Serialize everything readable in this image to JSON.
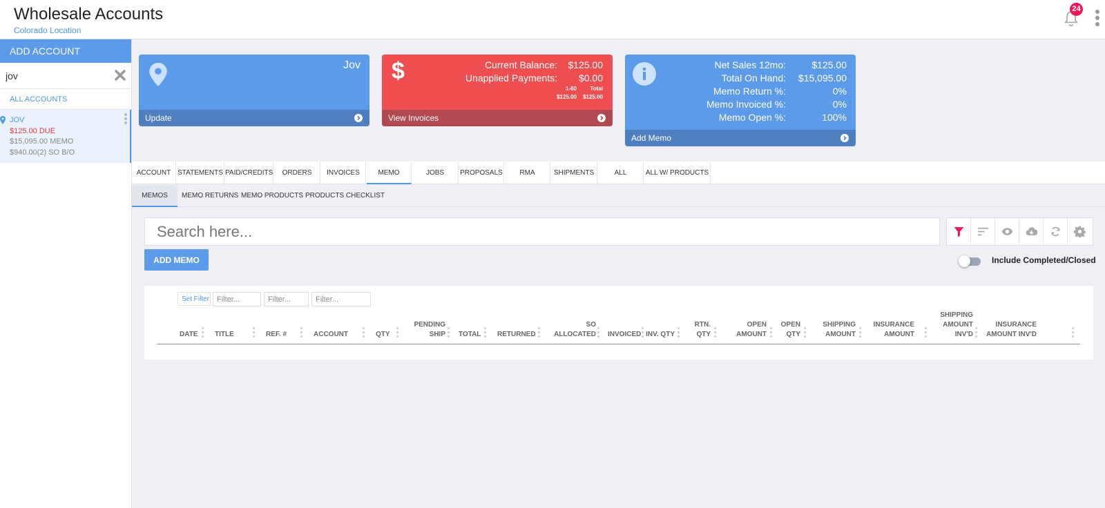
{
  "app": {
    "title": "Wholesale Accounts",
    "subtitle": "Colorado Location",
    "notifications": "24"
  },
  "sidebar": {
    "add_label": "ADD ACCOUNT",
    "search_value": "jov",
    "all_accounts": "ALL ACCOUNTS",
    "account": {
      "name": "JOV",
      "due": "$125.00 DUE",
      "memo": "$15,095.00 MEMO",
      "so_bo": "$940.00(2) SO B/O"
    }
  },
  "cards": {
    "account": {
      "name": "Jov",
      "footer": "Update"
    },
    "balance": {
      "current_label": "Current Balance:",
      "current_value": "$125.00",
      "unapplied_label": "Unapplied Payments:",
      "unapplied_value": "$0.00",
      "aging_head_1": "1-60",
      "aging_head_2": "Total",
      "aging_val_1": "$125.00",
      "aging_val_2": "$125.00",
      "footer": "View Invoices"
    },
    "memo": {
      "rows": [
        {
          "label": "Net Sales 12mo:",
          "value": "$125.00"
        },
        {
          "label": "Total On Hand:",
          "value": "$15,095.00"
        },
        {
          "label": "Memo Return %:",
          "value": "0%"
        },
        {
          "label": "Memo Invoiced %:",
          "value": "0%"
        },
        {
          "label": "Memo Open %:",
          "value": "100%"
        }
      ],
      "footer": "Add Memo"
    }
  },
  "tabs": [
    "ACCOUNT",
    "STATEMENTS",
    "PAID/CREDITS",
    "ORDERS",
    "INVOICES",
    "MEMO",
    "JOBS",
    "PROPOSALS",
    "RMA",
    "SHIPMENTS",
    "ALL",
    "ALL W/ PRODUCTS"
  ],
  "active_tab": "MEMO",
  "subtabs": [
    "MEMOS",
    "MEMO RETURNS",
    "MEMO PRODUCTS",
    "PRODUCTS CHECKLIST"
  ],
  "active_subtab": "MEMOS",
  "search": {
    "placeholder": "Search here..."
  },
  "toolbar": {
    "icons": [
      "filter-icon",
      "sort-icon",
      "eye-icon",
      "cloud-download-icon",
      "refresh-icon",
      "gear-icon"
    ],
    "filter_color": "#e8185a"
  },
  "add_memo_label": "ADD MEMO",
  "include_completed_label": "Include Completed/Closed",
  "grid": {
    "set_filter_label": "Set Filter",
    "filter_placeholder": "Filter...",
    "columns": [
      "DATE",
      "TITLE",
      "REF. #",
      "ACCOUNT",
      "QTY",
      "PENDING SHIP",
      "TOTAL",
      "RETURNED",
      "SO ALLOCATED",
      "INVOICED",
      "INV. QTY",
      "RTN. QTY",
      "OPEN AMOUNT",
      "OPEN QTY",
      "SHIPPING AMOUNT",
      "INSURANCE AMOUNT",
      "SHIPPING AMOUNT INV'D",
      "INSURANCE AMOUNT INV'D"
    ]
  },
  "colors": {
    "accent": "#5c9aea",
    "danger": "#ef4e50",
    "badge": "#e8185a"
  }
}
